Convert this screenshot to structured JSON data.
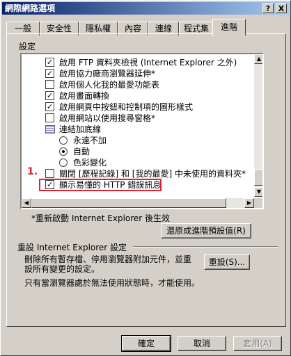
{
  "window": {
    "title": "網際網路選項",
    "help_btn": "?",
    "close_btn": "X"
  },
  "tabs": [
    "一般",
    "安全性",
    "隱私權",
    "內容",
    "連線",
    "程式集",
    "進階"
  ],
  "settings_label": "設定",
  "settings_items": [
    {
      "type": "checkbox",
      "checked": true,
      "label": "啟用 FTP 資料夾檢視 (Internet Explorer 之外)"
    },
    {
      "type": "checkbox",
      "checked": true,
      "label": "啟用協力廠商瀏覽器延伸*"
    },
    {
      "type": "checkbox",
      "checked": false,
      "label": "啟用個人化我的最愛功能表"
    },
    {
      "type": "checkbox",
      "checked": true,
      "label": "啟用畫面轉換"
    },
    {
      "type": "checkbox",
      "checked": true,
      "label": "啟用網頁中按鈕和控制項的圖形樣式"
    },
    {
      "type": "checkbox",
      "checked": false,
      "label": "啟用網站以使用搜尋窗格*"
    },
    {
      "type": "group",
      "label": "連結加底線"
    },
    {
      "type": "radio",
      "checked": false,
      "label": "永遠不加"
    },
    {
      "type": "radio",
      "checked": true,
      "label": "自動"
    },
    {
      "type": "radio",
      "checked": false,
      "label": "色彩變化"
    },
    {
      "type": "checkbox",
      "checked": false,
      "label": "關閉 [歷程記錄] 和 [我的最愛] 中未使用的資料夾*"
    },
    {
      "type": "checkbox",
      "checked": true,
      "label": "顯示易懂的 HTTP 錯誤訊息"
    }
  ],
  "annotation_number": "1.",
  "restart_note": "*重新啟動 Internet Explorer 後生效",
  "restore_button": "還原成進階預設值(R)",
  "reset_group_label": "重設 Internet Explorer 設定",
  "reset_description_line1": "刪除所有暫存檔、停用瀏覽器附加元件，並重",
  "reset_description_line2": "設所有變更的設定。",
  "reset_button": "重設(S)...",
  "reset_note": "只有當瀏覽器處於無法使用狀態時，才能使用。",
  "footer": {
    "ok": "確定",
    "cancel": "取消",
    "apply": "套用(A)"
  },
  "colors": {
    "title_start": "#0a246a",
    "title_end": "#a6caf0",
    "highlight": "#e02030"
  }
}
